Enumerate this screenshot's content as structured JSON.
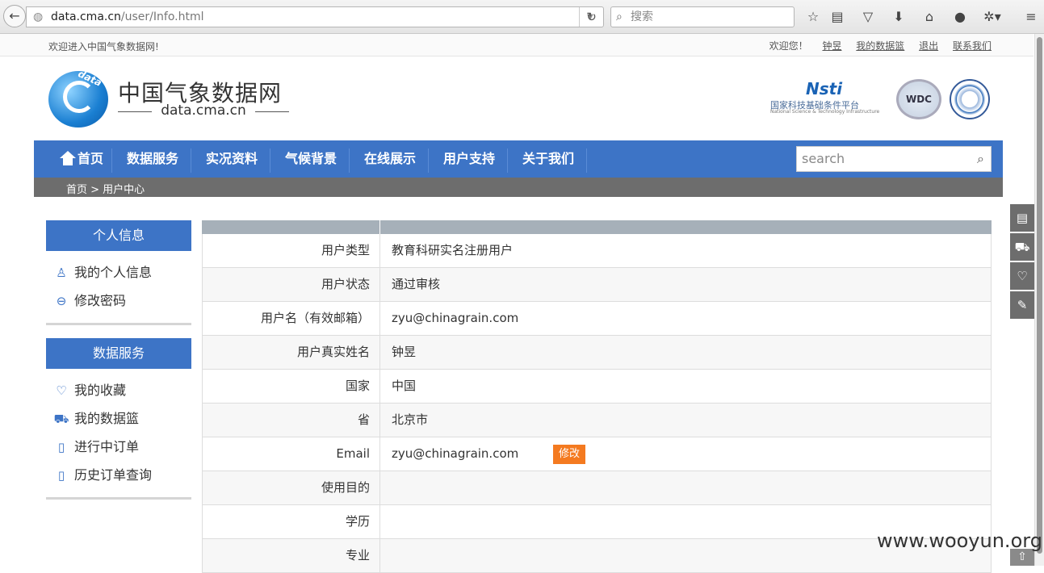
{
  "browser": {
    "url_host": "data.cma.cn",
    "url_path": "/user/Info.html",
    "search_placeholder": "搜索"
  },
  "topbar": {
    "welcome": "欢迎进入中国气象数据网!",
    "greeting": "欢迎您！",
    "username": "钟昱",
    "my_basket": "我的数据篮",
    "logout": "退出",
    "contact": "联系我们"
  },
  "header": {
    "logo_text": "data",
    "site_name": "中国气象数据网",
    "site_domain": "data.cma.cn",
    "nsti_mark": "Nsti",
    "nsti_cn": "国家科技基础条件平台",
    "nsti_en": "National Science & Technology Infrastructure",
    "wdc": "WDC"
  },
  "nav": {
    "items": [
      "首页",
      "数据服务",
      "实况资料",
      "气候背景",
      "在线展示",
      "用户支持",
      "关于我们"
    ],
    "search_placeholder": "search"
  },
  "breadcrumb": "首页 > 用户中心",
  "sidebar": {
    "section1_title": "个人信息",
    "section1_items": [
      "我的个人信息",
      "修改密码"
    ],
    "section2_title": "数据服务",
    "section2_items": [
      "我的收藏",
      "我的数据篮",
      "进行中订单",
      "历史订单查询"
    ]
  },
  "info_rows": [
    {
      "label": "用户类型",
      "value": "教育科研实名注册用户"
    },
    {
      "label": "用户状态",
      "value": "通过审核"
    },
    {
      "label": "用户名（有效邮箱）",
      "value": "zyu@chinagrain.com"
    },
    {
      "label": "用户真实姓名",
      "value": "钟昱"
    },
    {
      "label": "国家",
      "value": "中国"
    },
    {
      "label": "省",
      "value": "北京市"
    },
    {
      "label": "Email",
      "value": "zyu@chinagrain.com"
    },
    {
      "label": "使用目的",
      "value": ""
    },
    {
      "label": "学历",
      "value": ""
    },
    {
      "label": "专业",
      "value": ""
    }
  ],
  "edit_button": "修改",
  "watermark": "www.wooyun.org"
}
